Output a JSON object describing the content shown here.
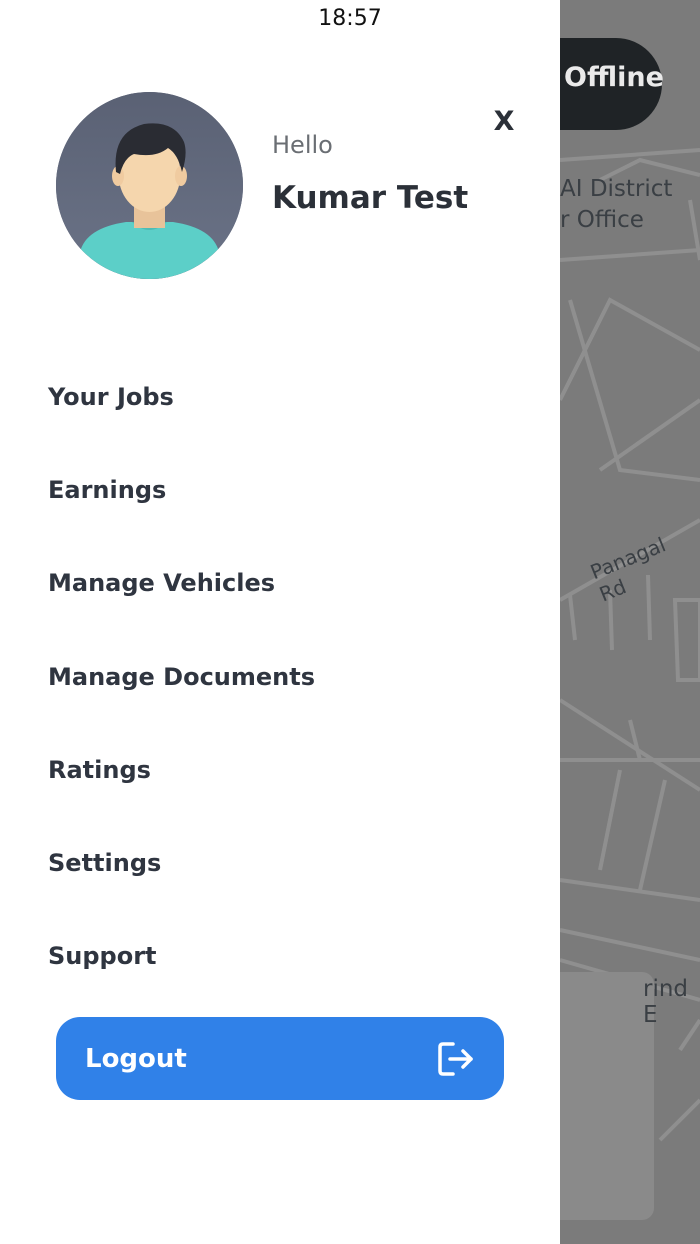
{
  "status_bar": {
    "time": "18:57"
  },
  "map": {
    "status_toggle": "Offline",
    "labels": {
      "district_line1": "AI District",
      "district_line2": "r Office",
      "road": "Panagal Rd",
      "bottom": "rind E"
    }
  },
  "drawer": {
    "greeting": "Hello",
    "user_name": "Kumar Test",
    "close_label": "X",
    "menu": [
      {
        "label": "Your Jobs"
      },
      {
        "label": "Earnings"
      },
      {
        "label": "Manage Vehicles"
      },
      {
        "label": "Manage Documents"
      },
      {
        "label": "Ratings"
      },
      {
        "label": "Settings"
      },
      {
        "label": "Support"
      }
    ],
    "logout_label": "Logout",
    "logout_icon": "logout-icon"
  },
  "colors": {
    "accent": "#3081e8",
    "text_dark": "#2f3540",
    "map_overlay": "#7b7b7b",
    "pill": "#1f2326"
  }
}
